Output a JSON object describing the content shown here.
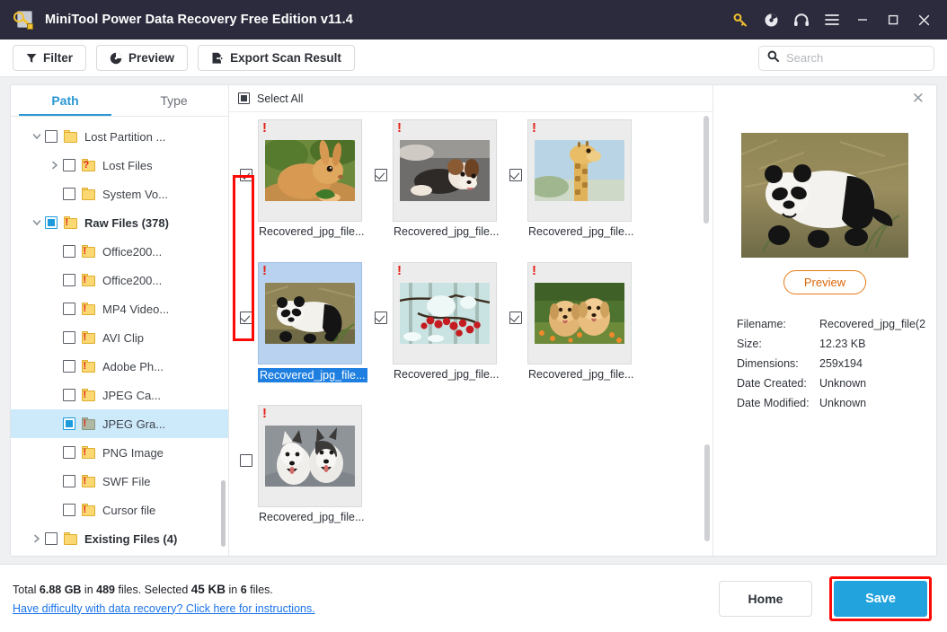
{
  "window": {
    "title": "MiniTool Power Data Recovery Free Edition v11.4",
    "icons": {
      "key": "key-icon",
      "disc": "disc-icon",
      "headphones": "headphones-icon",
      "menu": "hamburger-menu-icon",
      "minimize": "minimize-icon",
      "maximize": "maximize-icon",
      "close": "close-icon"
    },
    "accent": "#23a3dd",
    "titlebar_bg": "#2b2b3d"
  },
  "toolbar": {
    "filter_label": "Filter",
    "preview_label": "Preview",
    "export_label": "Export Scan Result",
    "search_placeholder": "Search",
    "search_value": ""
  },
  "sidebar": {
    "tabs": [
      {
        "label": "Path",
        "active": true
      },
      {
        "label": "Type",
        "active": false
      }
    ],
    "items": [
      {
        "label": "Lost Partition ...",
        "indent": 0,
        "caret": "down",
        "check": "unchecked",
        "icon": "folder-plain",
        "bold": false,
        "selected": false
      },
      {
        "label": "Lost Files",
        "indent": 1,
        "caret": "right",
        "check": "unchecked",
        "icon": "folder-question",
        "bold": false,
        "selected": false
      },
      {
        "label": "System Vo...",
        "indent": 1,
        "caret": "none",
        "check": "unchecked",
        "icon": "folder-plain",
        "bold": false,
        "selected": false
      },
      {
        "label": "Raw Files (378)",
        "indent": 0,
        "caret": "down",
        "check": "partial-blue",
        "icon": "folder-warning",
        "bold": true,
        "selected": false
      },
      {
        "label": "Office200...",
        "indent": 1,
        "caret": "none",
        "check": "unchecked",
        "icon": "folder-warning",
        "bold": false,
        "selected": false
      },
      {
        "label": "Office200...",
        "indent": 1,
        "caret": "none",
        "check": "unchecked",
        "icon": "folder-warning",
        "bold": false,
        "selected": false
      },
      {
        "label": "MP4 Video...",
        "indent": 1,
        "caret": "none",
        "check": "unchecked",
        "icon": "folder-warning",
        "bold": false,
        "selected": false
      },
      {
        "label": "AVI Clip",
        "indent": 1,
        "caret": "none",
        "check": "unchecked",
        "icon": "folder-warning",
        "bold": false,
        "selected": false
      },
      {
        "label": "Adobe Ph...",
        "indent": 1,
        "caret": "none",
        "check": "unchecked",
        "icon": "folder-warning",
        "bold": false,
        "selected": false
      },
      {
        "label": "JPEG Ca...",
        "indent": 1,
        "caret": "none",
        "check": "unchecked",
        "icon": "folder-warning",
        "bold": false,
        "selected": false
      },
      {
        "label": "JPEG Gra...",
        "indent": 1,
        "caret": "none",
        "check": "partial-blue",
        "icon": "folder-warning-green",
        "bold": false,
        "selected": true
      },
      {
        "label": "PNG Image",
        "indent": 1,
        "caret": "none",
        "check": "unchecked",
        "icon": "folder-warning",
        "bold": false,
        "selected": false
      },
      {
        "label": "SWF File",
        "indent": 1,
        "caret": "none",
        "check": "unchecked",
        "icon": "folder-warning",
        "bold": false,
        "selected": false
      },
      {
        "label": "Cursor file",
        "indent": 1,
        "caret": "none",
        "check": "unchecked",
        "icon": "folder-warning",
        "bold": false,
        "selected": false
      },
      {
        "label": "Existing Files (4)",
        "indent": 0,
        "caret": "right",
        "check": "unchecked",
        "icon": "folder-plain",
        "bold": true,
        "selected": false
      }
    ]
  },
  "grid": {
    "select_all_label": "Select All",
    "select_all_state": "partial",
    "items": [
      {
        "caption": "Recovered_jpg_file...",
        "checked": true,
        "selected": false,
        "warning": true,
        "subject": "rabbit"
      },
      {
        "caption": "Recovered_jpg_file...",
        "checked": true,
        "selected": false,
        "warning": true,
        "subject": "beagle-puppy"
      },
      {
        "caption": "Recovered_jpg_file...",
        "checked": true,
        "selected": false,
        "warning": true,
        "subject": "giraffe"
      },
      {
        "caption": "Recovered_jpg_file...",
        "checked": true,
        "selected": true,
        "warning": true,
        "subject": "panda"
      },
      {
        "caption": "Recovered_jpg_file...",
        "checked": true,
        "selected": false,
        "warning": true,
        "subject": "red-berries-snow"
      },
      {
        "caption": "Recovered_jpg_file...",
        "checked": true,
        "selected": false,
        "warning": true,
        "subject": "golden-retriever-puppies"
      },
      {
        "caption": "Recovered_jpg_file...",
        "checked": false,
        "selected": false,
        "warning": true,
        "subject": "huskies"
      }
    ]
  },
  "preview": {
    "close_icon": "close-icon",
    "image_subject": "panda",
    "button_label": "Preview",
    "fields": [
      {
        "key": "Filename:",
        "value": "Recovered_jpg_file(2"
      },
      {
        "key": "Size:",
        "value": "12.23 KB"
      },
      {
        "key": "Dimensions:",
        "value": "259x194"
      },
      {
        "key": "Date Created:",
        "value": "Unknown"
      },
      {
        "key": "Date Modified:",
        "value": "Unknown"
      }
    ]
  },
  "footer": {
    "total_prefix": "Total ",
    "total_size": "6.88 GB",
    "total_mid": " in ",
    "total_count": "489",
    "total_suffix": " files.",
    "selected_prefix": "  Selected ",
    "selected_size": "45 KB",
    "selected_mid": " in ",
    "selected_count": "6",
    "selected_suffix": " files.",
    "help_link": "Have difficulty with data recovery? Click here for instructions.",
    "home_label": "Home",
    "save_label": "Save"
  }
}
